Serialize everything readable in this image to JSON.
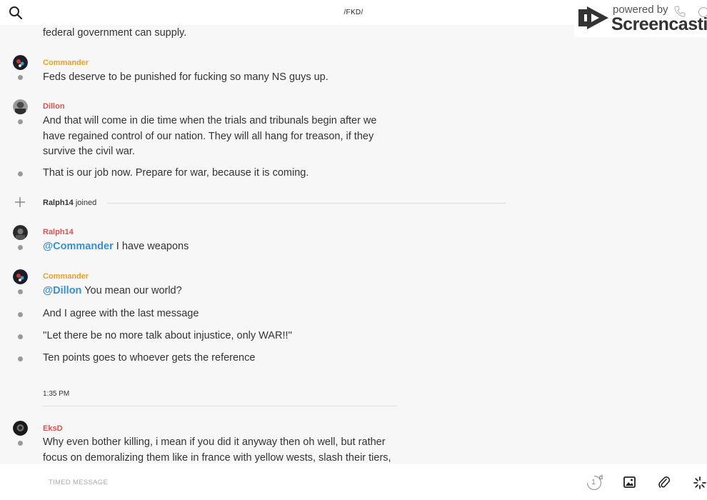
{
  "header": {
    "title": "/FKD/",
    "search_icon": "search-icon"
  },
  "watermark": {
    "powered_by": "powered by",
    "brand": "Screencastify",
    "icons": [
      "screencastify-logo-icon",
      "phone-icon",
      "info-icon"
    ]
  },
  "feed": {
    "cut_off_text": "federal government can supply.",
    "messages": [
      {
        "author": "Commander",
        "lines": [
          "Feds deserve to be punished for fucking so many NS guys up."
        ]
      },
      {
        "author": "Dillon",
        "lines": [
          "And that will come in die time when the trials and tribunals begin after we have regained control of our nation. They will all hang for treason, if they survive the civil war.",
          "That is our job now. Prepare for war, because it is coming."
        ]
      },
      {
        "author": "Ralph14",
        "mention": "@Commander",
        "lines": [
          " I have weapons"
        ]
      },
      {
        "author": "Commander",
        "mention": "@Dillon",
        "lines": [
          " You mean our world?",
          "And I agree with the last message",
          "''Let there be no more talk about injustice, only WAR!!''",
          "Ten points goes to whoever gets the reference"
        ]
      },
      {
        "author": "EksD",
        "lines": [
          "Why even bother killing, i mean if you did it anyway then oh well, but rather focus on demoralizing them like in france with yellow wests, slash their tiers,"
        ]
      }
    ],
    "join_event": {
      "user": "Ralph14",
      "suffix": " joined"
    },
    "time_divider": "1:35 PM"
  },
  "composer": {
    "placeholder": "TIMED MESSAGE",
    "timer_value": "1",
    "timer_unit": "d",
    "icons": [
      "timer-icon",
      "image-icon",
      "paperclip-icon",
      "spinner-icon"
    ]
  },
  "colors": {
    "author_orange": "#e8a02a",
    "author_red": "#d9534f",
    "mention_blue": "#3b8fcf",
    "background": "#f7f7f7"
  }
}
